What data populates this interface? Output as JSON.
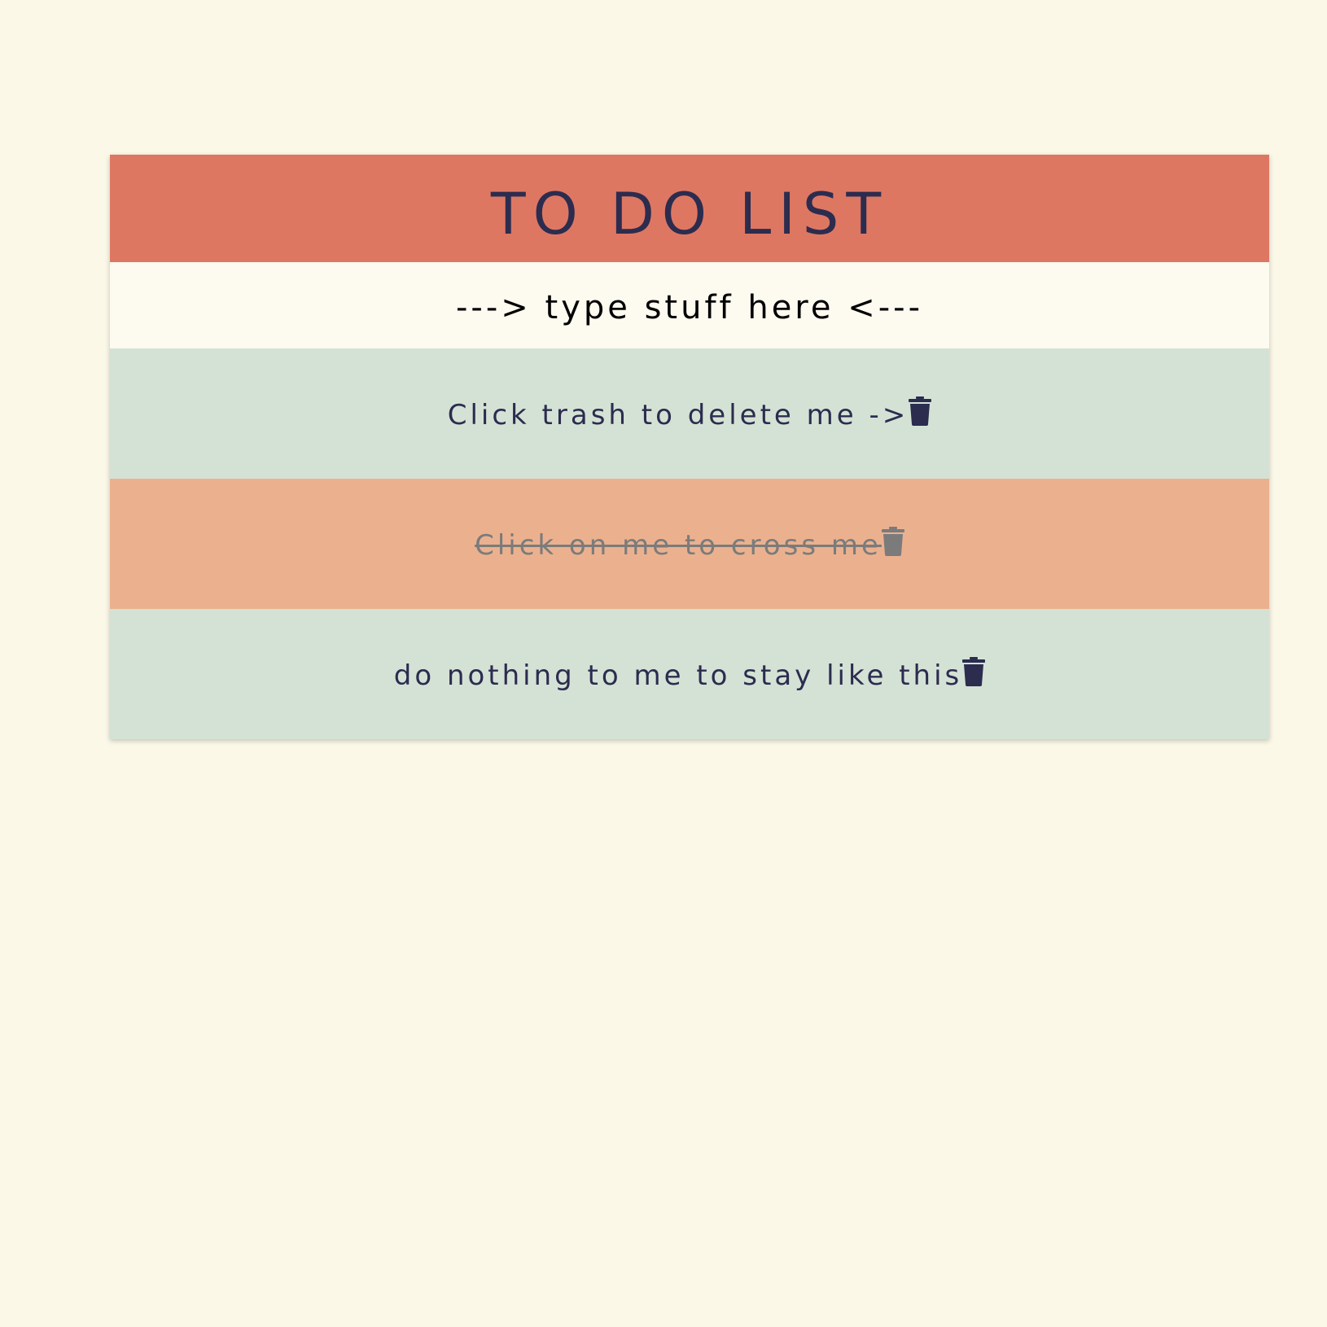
{
  "header": {
    "title": "TO DO LIST"
  },
  "input": {
    "placeholder": "---> type stuff here <---",
    "value": ""
  },
  "todos": [
    {
      "text": "Click trash to delete me ->",
      "completed": false,
      "row_color": "#d4e2d5",
      "icon": "trash-icon"
    },
    {
      "text": "Click on me to cross me",
      "completed": true,
      "row_color": "#ebb18f",
      "icon": "trash-icon"
    },
    {
      "text": "do nothing to me to stay like this",
      "completed": false,
      "row_color": "#d4e2d5",
      "icon": "trash-icon"
    }
  ],
  "colors": {
    "page_background": "#fbf8e8",
    "header_background": "#de7762",
    "input_background": "#fdfaf0",
    "text_primary": "#2c2c4f",
    "text_completed": "#7b7b7b"
  }
}
